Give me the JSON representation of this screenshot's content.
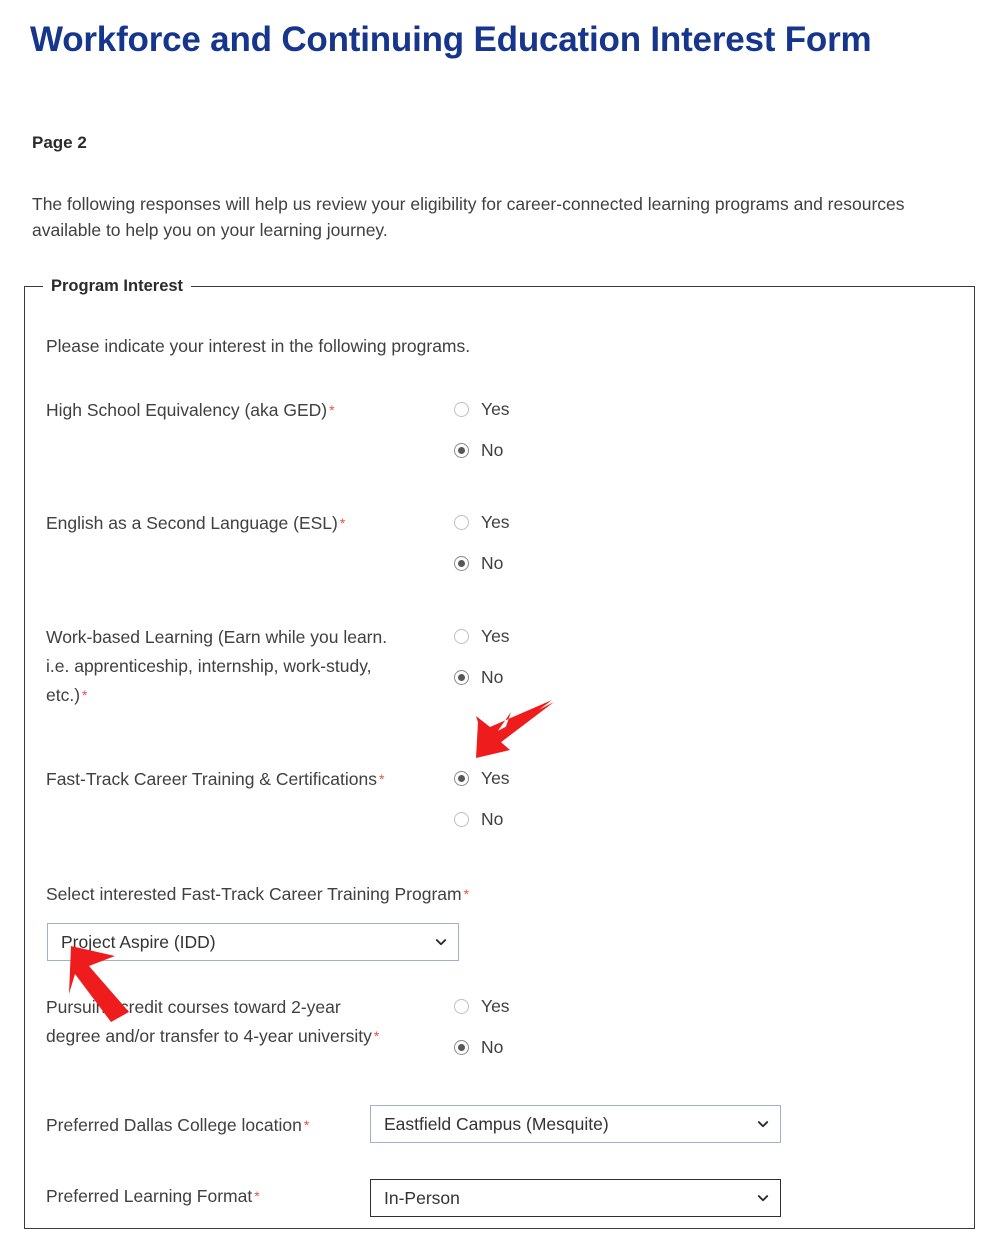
{
  "form": {
    "title": "Workforce and Continuing Education Interest Form",
    "page_label": "Page 2",
    "intro": "The following responses will help us review your eligibility for career-connected learning programs and resources available to help you on your learning journey."
  },
  "colors": {
    "title_blue": "#16358c",
    "required_asterisk": "#e8504a",
    "annotation_red": "#ee1c1c",
    "fieldset_border": "#3a3a3a",
    "select_border_light": "#9fb2cc",
    "select_border_dark": "#2e2e2e",
    "radio_selected_dot": "#585858",
    "text": "#404040"
  },
  "fieldset": {
    "legend": "Program Interest",
    "instruction": "Please indicate your interest in the following programs."
  },
  "questions": [
    {
      "id": "high-school-equivalency",
      "label": "High School Equivalency (aka GED)",
      "required_marker": "*",
      "type": "radio",
      "options": [
        "Yes",
        "No"
      ],
      "selected": "No"
    },
    {
      "id": "english-second-language",
      "label": "English as a Second Language (ESL)",
      "required_marker": "*",
      "type": "radio",
      "options": [
        "Yes",
        "No"
      ],
      "selected": "No"
    },
    {
      "id": "work-based-learning",
      "label_line_1": "Work-based Learning (Earn while you learn.",
      "label_line_2": "i.e. apprenticeship, internship, work-study,",
      "label_line_3": "etc.)",
      "required_marker": "*",
      "type": "radio",
      "options": [
        "Yes",
        "No"
      ],
      "selected": "No"
    },
    {
      "id": "fast-track-career-training",
      "label": "Fast-Track Career Training & Certifications",
      "required_marker": "*",
      "type": "radio",
      "options": [
        "Yes",
        "No"
      ],
      "selected": "Yes"
    },
    {
      "id": "fast-track-program-select",
      "label": "Select interested Fast-Track Career Training Program",
      "required_marker": "*",
      "type": "select",
      "value": "Project Aspire (IDD)"
    },
    {
      "id": "pursuing-credit-courses",
      "label_line_1": "Pursuing credit courses toward 2-year",
      "label_line_2": "degree and/or transfer to 4-year university",
      "required_marker": "*",
      "type": "radio",
      "options": [
        "Yes",
        "No"
      ],
      "selected": "No"
    },
    {
      "id": "preferred-location",
      "label": "Preferred Dallas College location",
      "required_marker": "*",
      "type": "select",
      "value": "Eastfield Campus (Mesquite)"
    },
    {
      "id": "preferred-learning-format",
      "label": "Preferred Learning Format",
      "required_marker": "*",
      "type": "select",
      "value": "In-Person"
    }
  ],
  "annotations": [
    {
      "id": "arrow-to-fast-track-yes",
      "icon": "arrow-down-left-icon",
      "direction": "down-left"
    },
    {
      "id": "arrow-to-program-select",
      "icon": "arrow-up-left-icon",
      "direction": "up-left"
    }
  ]
}
